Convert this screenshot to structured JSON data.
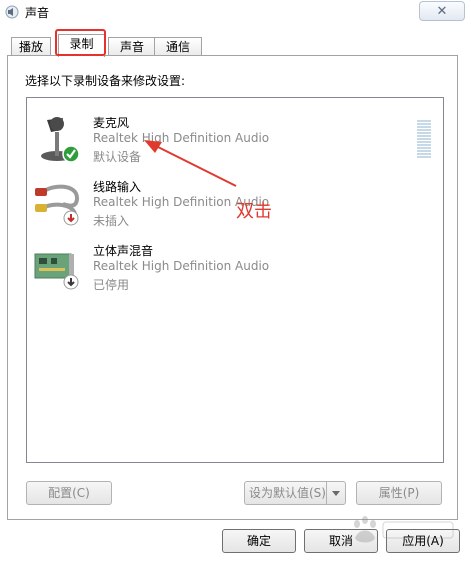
{
  "window": {
    "title": "声音",
    "close_label": "✕"
  },
  "tabs": [
    {
      "label": "播放",
      "active": false
    },
    {
      "label": "录制",
      "active": true
    },
    {
      "label": "声音",
      "active": false
    },
    {
      "label": "通信",
      "active": false
    }
  ],
  "panel": {
    "instruction": "选择以下录制设备来修改设置:"
  },
  "devices": [
    {
      "name": "麦克风",
      "driver": "Realtek High Definition Audio",
      "status": "默认设备",
      "icon": "microphone-icon",
      "badge": "default-check"
    },
    {
      "name": "线路输入",
      "driver": "Realtek High Definition Audio",
      "status": "未插入",
      "icon": "line-in-cable-icon",
      "badge": "unplugged-red"
    },
    {
      "name": "立体声混音",
      "driver": "Realtek High Definition Audio",
      "status": "已停用",
      "icon": "sound-card-icon",
      "badge": "disabled-down"
    }
  ],
  "buttons": {
    "configure": "配置(C)",
    "set_default": "设为默认值(S)",
    "properties": "属性(P)",
    "ok": "确定",
    "cancel": "取消",
    "apply": "应用(A)"
  },
  "annotation": {
    "text": "双击"
  },
  "colors": {
    "highlight": "#e5322d",
    "annotation": "#e03a2f",
    "status_text": "#8a8a8a"
  }
}
